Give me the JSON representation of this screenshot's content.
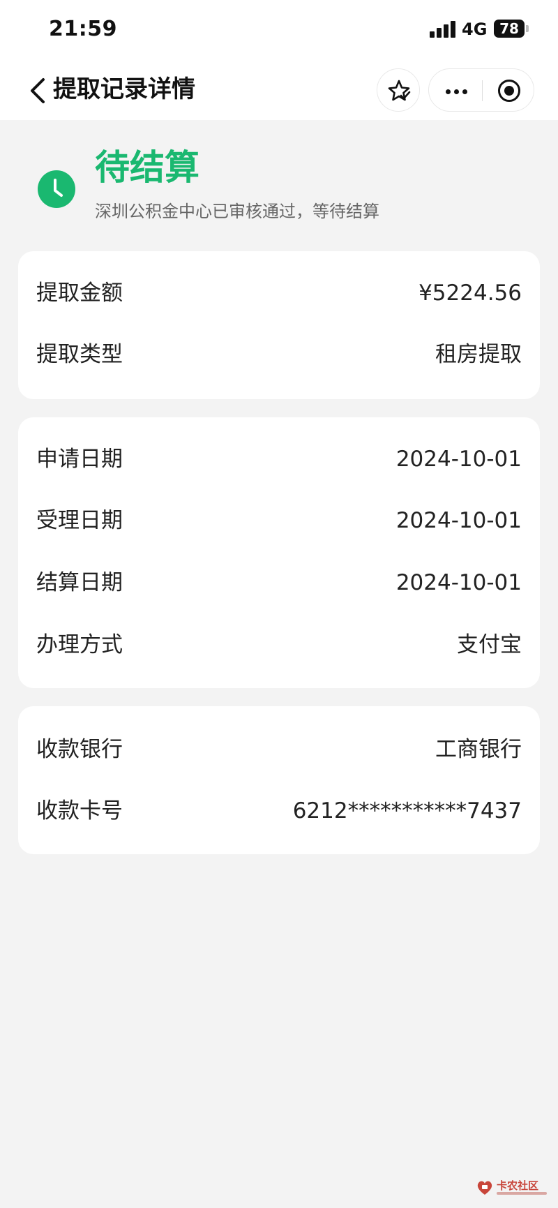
{
  "status_bar": {
    "time": "21:59",
    "network": "4G",
    "battery": "78"
  },
  "nav": {
    "title": "提取记录详情",
    "icons": {
      "back": "chevron-left-icon",
      "favorite": "star-check-icon",
      "more": "more-dots-icon",
      "close": "target-close-icon"
    }
  },
  "status": {
    "title": "待结算",
    "description": "深圳公积金中心已审核通过，等待结算",
    "icon": "clock-icon",
    "color": "#1ab870"
  },
  "cards": {
    "amount": [
      {
        "label": "提取金额",
        "value": "¥5224.56"
      },
      {
        "label": "提取类型",
        "value": "租房提取"
      }
    ],
    "dates": [
      {
        "label": "申请日期",
        "value": "2024-10-01"
      },
      {
        "label": "受理日期",
        "value": "2024-10-01"
      },
      {
        "label": "结算日期",
        "value": "2024-10-01"
      },
      {
        "label": "办理方式",
        "value": "支付宝"
      }
    ],
    "bank": [
      {
        "label": "收款银行",
        "value": "工商银行"
      },
      {
        "label": "收款卡号",
        "value": "6212***********7437"
      }
    ]
  },
  "watermark": {
    "text": "卡农社区"
  }
}
